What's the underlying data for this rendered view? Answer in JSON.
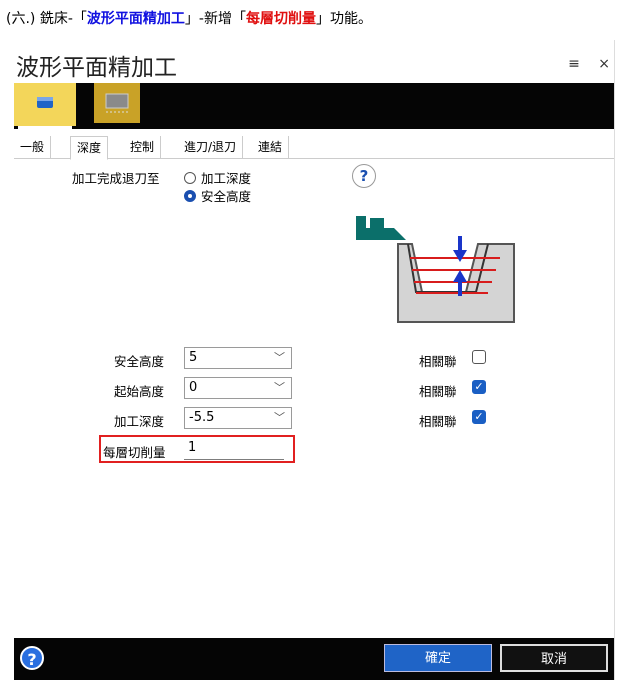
{
  "caption": {
    "prefix": "(六.) 銑床-「",
    "highlight1": "波形平面精加工",
    "middle": "」-新增「",
    "highlight2": "每層切削量",
    "suffix": "」功能。"
  },
  "window": {
    "title": "波形平面精加工",
    "menu_icon": "≡",
    "close_icon": "×"
  },
  "tabs": [
    "一般",
    "深度",
    "控制",
    "進刀/退刀",
    "連結"
  ],
  "active_tab": "深度",
  "retract": {
    "label": "加工完成退刀至",
    "options": [
      "加工深度",
      "安全高度"
    ],
    "selected": "安全高度"
  },
  "fields": [
    {
      "label": "安全高度",
      "value": "5",
      "related_label": "相關聯",
      "related": false
    },
    {
      "label": "起始高度",
      "value": "0",
      "related_label": "相關聯",
      "related": true
    },
    {
      "label": "加工深度",
      "value": "-5.5",
      "related_label": "相關聯",
      "related": true
    }
  ],
  "step": {
    "label": "每層切削量",
    "value": "1"
  },
  "footer": {
    "ok": "確定",
    "cancel": "取消",
    "help": "?"
  },
  "colors": {
    "accent": "#1f64c7",
    "highlight_box": "#e12020",
    "toolbar": "#050505",
    "toolbar_button": "#f3d65a"
  }
}
